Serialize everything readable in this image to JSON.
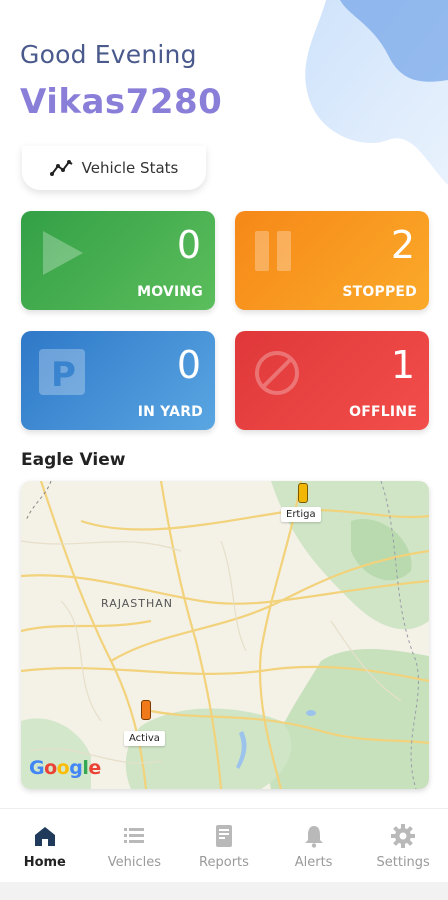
{
  "header": {
    "greeting": "Good Evening",
    "username": "Vikas7280"
  },
  "stats_button": {
    "label": "Vehicle Stats",
    "icon": "line-chart-icon"
  },
  "status_cards": [
    {
      "id": "moving",
      "count": "0",
      "label": "MOVING",
      "icon": "play-icon",
      "color": "#3FAE4E"
    },
    {
      "id": "stopped",
      "count": "2",
      "label": "STOPPED",
      "icon": "pause-icon",
      "color": "#F79321"
    },
    {
      "id": "yard",
      "count": "0",
      "label": "IN YARD",
      "icon": "parking-icon",
      "color": "#3C8DD6"
    },
    {
      "id": "offline",
      "count": "1",
      "label": "OFFLINE",
      "icon": "prohibited-icon",
      "color": "#E94141"
    }
  ],
  "eagle_view": {
    "title": "Eagle View",
    "region_label": "RAJASTHAN",
    "vehicles": [
      {
        "name": "Ertiga"
      },
      {
        "name": "Activa"
      }
    ],
    "attribution": "Google"
  },
  "bottom_nav": {
    "items": [
      {
        "label": "Home",
        "icon": "home-icon",
        "active": true
      },
      {
        "label": "Vehicles",
        "icon": "list-icon",
        "active": false
      },
      {
        "label": "Reports",
        "icon": "report-icon",
        "active": false
      },
      {
        "label": "Alerts",
        "icon": "bell-icon",
        "active": false
      },
      {
        "label": "Settings",
        "icon": "gear-icon",
        "active": false
      }
    ]
  }
}
